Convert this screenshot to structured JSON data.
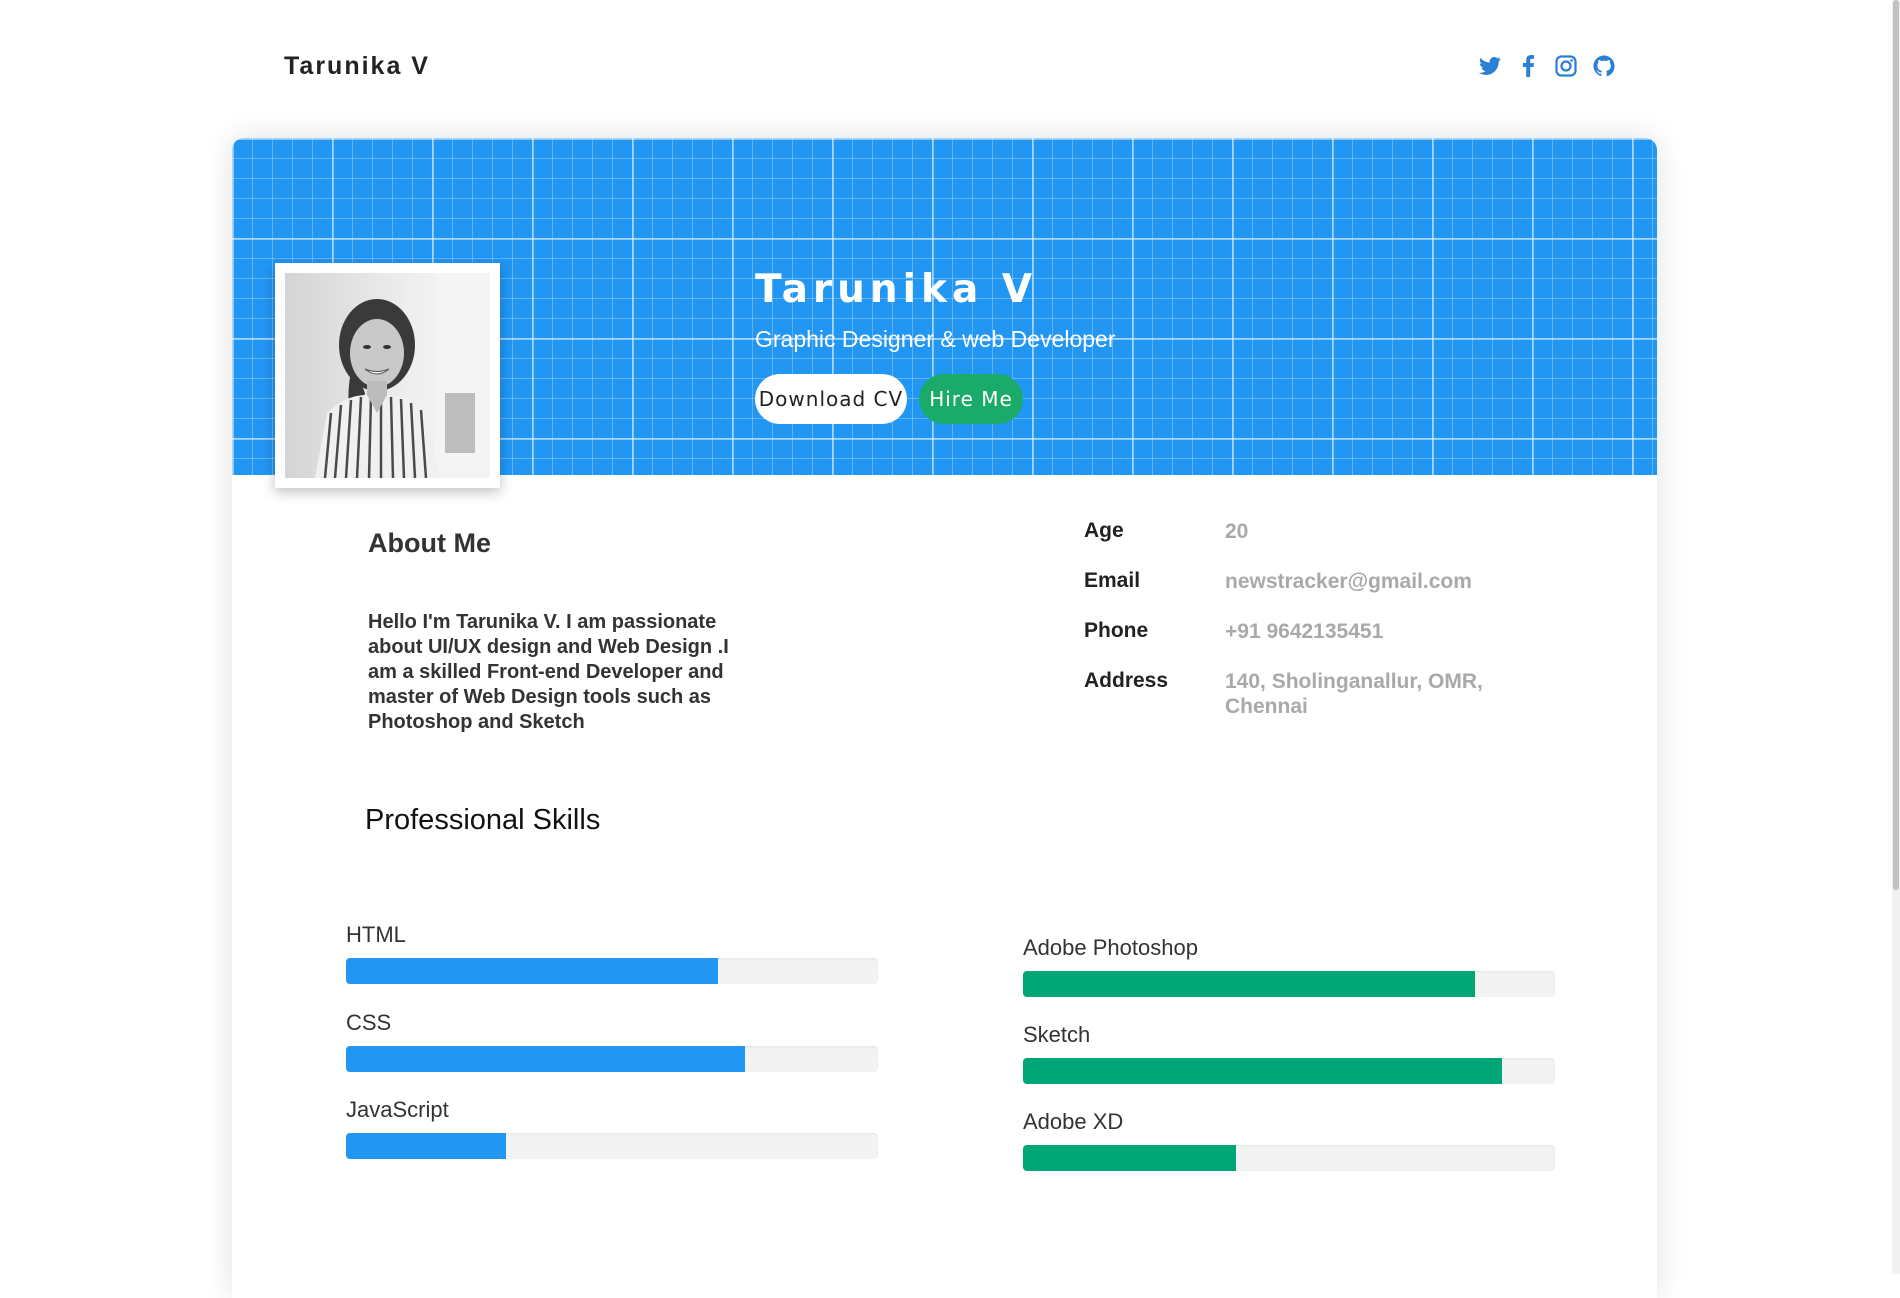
{
  "nav": {
    "brand": "Tarunika V",
    "social": [
      "twitter-icon",
      "facebook-icon",
      "instagram-icon",
      "github-icon"
    ]
  },
  "hero": {
    "name": "Tarunika V",
    "role": "Graphic Designer & web Developer",
    "download_cv": "Download CV",
    "hire_me": "Hire Me"
  },
  "about": {
    "title": "About Me",
    "text": "Hello I'm Tarunika V. I am passionate about UI/UX design and Web Design .I am a skilled Front-end Developer and master of Web Design tools such as Photoshop and Sketch"
  },
  "info": {
    "age_label": "Age",
    "age": "20",
    "email_label": "Email",
    "email": "newstracker@gmail.com",
    "phone_label": "Phone",
    "phone": "+91 9642135451",
    "address_label": "Address",
    "address": "140, Sholinganallur, OMR, Chennai"
  },
  "skills": {
    "title": "Professional Skills",
    "left": [
      {
        "name": "HTML",
        "percent": 70
      },
      {
        "name": "CSS",
        "percent": 75
      },
      {
        "name": "JavaScript",
        "percent": 30
      }
    ],
    "right": [
      {
        "name": "Adobe Photoshop",
        "percent": 85
      },
      {
        "name": "Sketch",
        "percent": 90
      },
      {
        "name": "Adobe XD",
        "percent": 40
      }
    ]
  },
  "colors": {
    "hero": "#2196f3",
    "hire": "#1aaa6a",
    "skill_blue": "#2196f3",
    "skill_green": "#00a676"
  }
}
